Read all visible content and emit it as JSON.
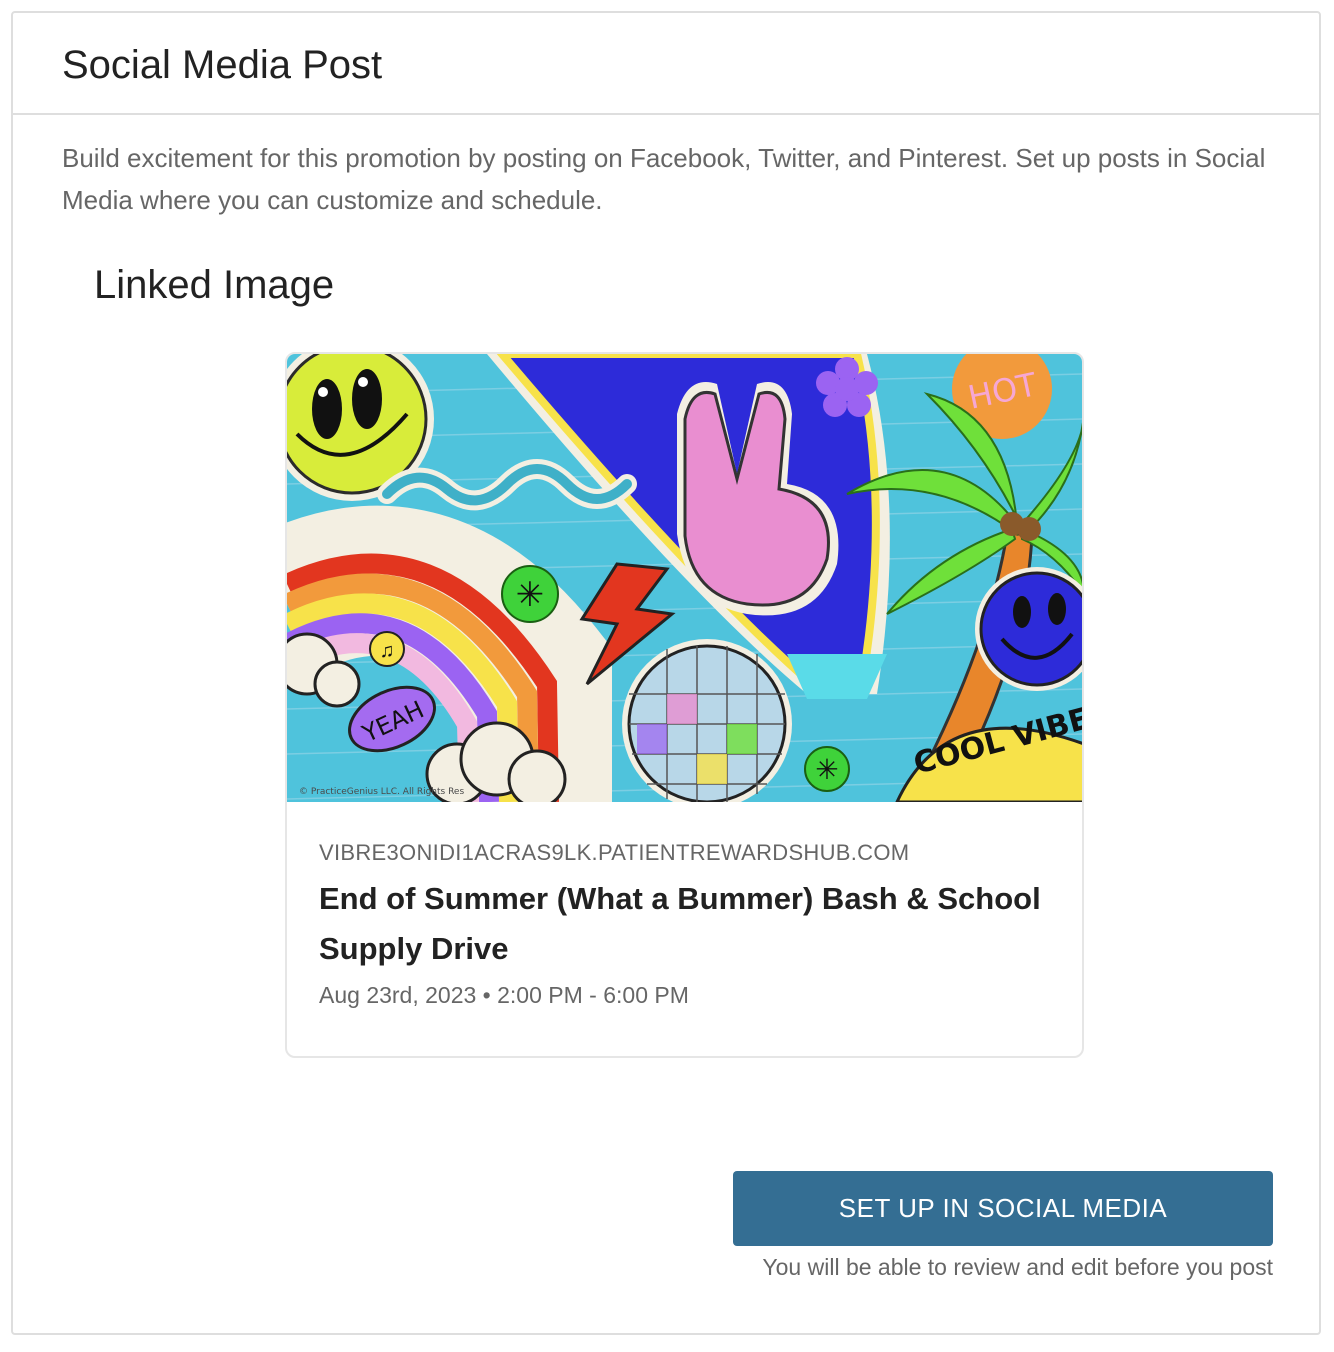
{
  "panel": {
    "title": "Social Media Post",
    "intro": "Build excitement for this promotion by posting on Facebook, Twitter, and Pinterest. Set up posts in Social Media where you can customize and schedule."
  },
  "linked_image": {
    "heading": "Linked Image",
    "card": {
      "url": "VIBRE3ONIDI1ACRAS9LK.PATIENTREWARDSHUB.COM",
      "title": "End of Summer (What a Bummer) Bash & School Supply Drive",
      "meta": "Aug 23rd, 2023 • 2:00 PM - 6:00 PM",
      "art_text": {
        "hot": "HOT",
        "yeah": "YEAH",
        "cool_vibe": "COOL VIBE",
        "copyright": "© PracticeGenius LLC. All Rights Res"
      }
    }
  },
  "actions": {
    "setup_button": "SET UP IN SOCIAL MEDIA",
    "setup_note": "You will be able to review and edit before you post"
  },
  "colors": {
    "button": "#346e93",
    "art_background": "#4fc3dc"
  }
}
